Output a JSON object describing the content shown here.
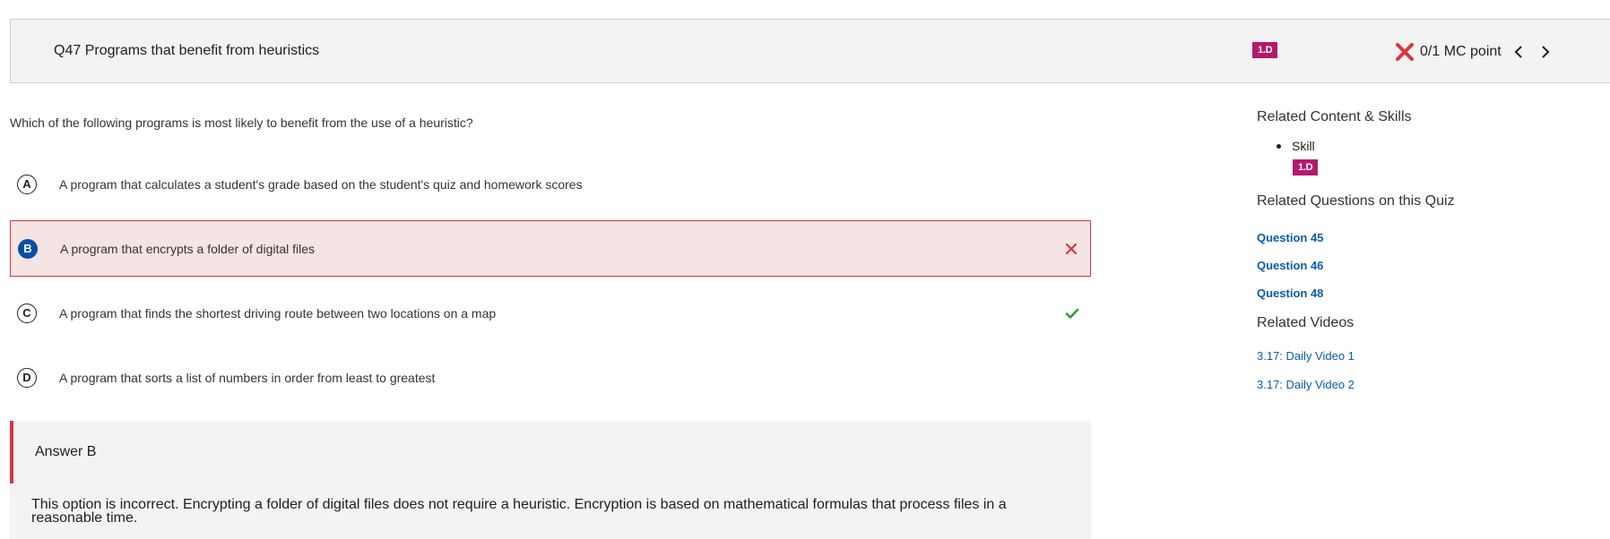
{
  "header": {
    "title": "Q47 Programs that benefit from heuristics",
    "skill_badge": "1.D",
    "score_text": "0/1 MC point"
  },
  "question": {
    "text": "Which of the following programs is most likely to benefit from the use of a heuristic?",
    "options": [
      {
        "letter": "A",
        "text": "A program that calculates a student's grade based on the student's quiz and homework scores"
      },
      {
        "letter": "B",
        "text": "A program that encrypts a folder of digital files",
        "selected": true,
        "mark": "incorrect"
      },
      {
        "letter": "C",
        "text": "A program that finds the shortest driving route between two locations on a map",
        "mark": "correct"
      },
      {
        "letter": "D",
        "text": "A program that sorts a list of numbers in order from least to greatest"
      }
    ]
  },
  "answer": {
    "title": "Answer B",
    "explanation": "This option is incorrect. Encrypting a folder of digital files does not require a heuristic. Encryption is based on mathematical formulas that process files in a reasonable time."
  },
  "sidebar": {
    "related_heading": "Related Content & Skills",
    "skill_label": "Skill",
    "skill_badge": "1.D",
    "related_questions_heading": "Related Questions on this Quiz",
    "questions": [
      "Question 45",
      "Question 46",
      "Question 48"
    ],
    "videos_heading": "Related Videos",
    "videos": [
      "3.17: Daily Video 1",
      "3.17: Daily Video 2"
    ]
  },
  "colors": {
    "skill_badge": "#b3196b",
    "incorrect": "#d9343f",
    "correct": "#2e9e3e",
    "selected_letter": "#0a4ea1",
    "link": "#0a5cab"
  },
  "icons": {
    "score": "x-icon",
    "prev": "chevron-left-icon",
    "next": "chevron-right-icon",
    "incorrect_mark": "x-mark-icon",
    "correct_mark": "check-icon"
  }
}
